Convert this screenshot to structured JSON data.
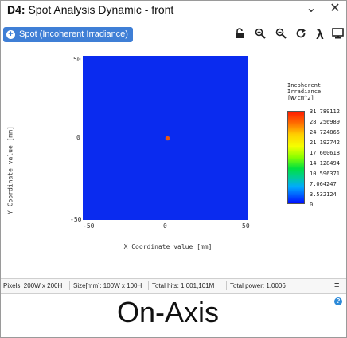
{
  "window": {
    "title_prefix": "D4:",
    "title_rest": " Spot Analysis Dynamic - front",
    "pin_icon": "pin-icon",
    "close_icon": "close-icon"
  },
  "toolbar": {
    "spot_button_label": "Spot (Incoherent Irradiance)",
    "icons": [
      "lock-icon",
      "zoom-in-icon",
      "zoom-out-icon",
      "refresh-icon",
      "lambda-icon",
      "monitor-icon"
    ]
  },
  "chart_data": {
    "type": "heatmap",
    "xlabel": "X Coordinate value [mm]",
    "ylabel": "Y Coordinate value [mm]",
    "xlim": [
      -50,
      50
    ],
    "ylim": [
      -50,
      50
    ],
    "x_ticks": [
      "-50",
      "0",
      "50"
    ],
    "y_ticks": [
      "50",
      "0",
      "-50"
    ],
    "background_value": 0,
    "spot": {
      "x": 1,
      "y": 0,
      "value": 31.789112
    },
    "colorbar": {
      "title_lines": [
        "Incoherent",
        "Irradiance",
        "[W/cm^2]"
      ],
      "labels": [
        "31.789112",
        "28.256989",
        "24.724865",
        "21.192742",
        "17.660618",
        "14.128494",
        "10.596371",
        "7.064247",
        "3.532124",
        "0"
      ]
    }
  },
  "status": {
    "pixels": "Pixels: 200W x 200H",
    "size": "Size[mm]: 100W x 100H",
    "hits": "Total hits: 1,001,101M",
    "power": "Total power: 1.0006"
  },
  "caption": "On-Axis"
}
